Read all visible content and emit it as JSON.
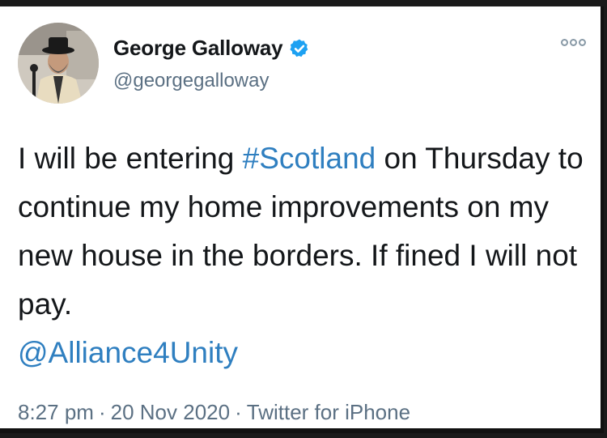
{
  "user": {
    "display_name": "George Galloway",
    "handle": "@georgegalloway",
    "verified": true,
    "avatar_icon": "profile-photo"
  },
  "tweet": {
    "segments": [
      {
        "text": "I will be entering ",
        "type": "text"
      },
      {
        "text": "#Scotland",
        "type": "hashtag"
      },
      {
        "text": " on Thursday to continue my home improvements on my new house in the borders. If fined I will not pay.",
        "type": "text"
      },
      {
        "text": "@Alliance4Unity",
        "type": "mention"
      }
    ]
  },
  "meta": {
    "time": "8:27 pm",
    "date": "20 Nov 2020",
    "source": "Twitter for iPhone",
    "separator": "·"
  },
  "colors": {
    "link": "#2f7fc0",
    "verified": "#1da1f2",
    "secondary_text": "#5b7083"
  },
  "icons": {
    "more": "more-options-icon",
    "verified": "verified-badge-icon"
  }
}
